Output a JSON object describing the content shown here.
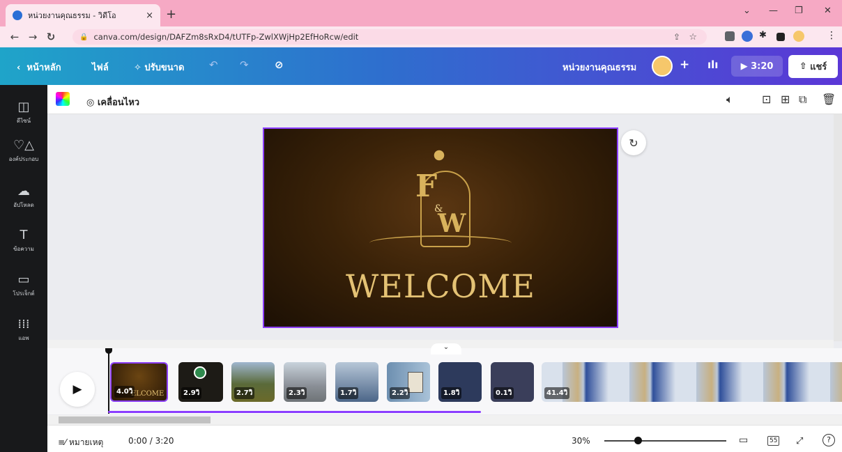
{
  "browser": {
    "tab_title": "หน่วยงานคุณธรรม - วิดีโอ",
    "tab_close": "×",
    "new_tab": "+",
    "url": "canva.com/design/DAFZm8sRxD4/tUTFp-ZwlXWjHp2EfHoRcw/edit",
    "window_controls": [
      "⌄",
      "—",
      "❐",
      "✕"
    ]
  },
  "canva_bar": {
    "home_label": "หน้าหลัก",
    "file_label": "ไฟล์",
    "resize_label": "ปรับขนาด",
    "design_title": "หน่วยงานคุณธรรม",
    "play_time": "3:20",
    "share_label": "แชร์"
  },
  "sidebar": {
    "items": [
      {
        "label": "ดีไซน์",
        "icon": "layout-icon"
      },
      {
        "label": "องค์ประกอบ",
        "icon": "elements-icon"
      },
      {
        "label": "อัปโหลด",
        "icon": "upload-icon"
      },
      {
        "label": "ข้อความ",
        "icon": "text-icon"
      },
      {
        "label": "โปรเจ็กต์",
        "icon": "folder-icon"
      },
      {
        "label": "แอพ",
        "icon": "apps-icon"
      }
    ]
  },
  "toolbar": {
    "animate_label": "เคลื่อนไหว"
  },
  "canvas": {
    "monogram_f": "F",
    "monogram_amp": "&",
    "monogram_w": "W",
    "welcome_text": "WELCOME"
  },
  "timeline": {
    "clips": [
      {
        "duration": "4.0วิ",
        "caption": "ELCOME",
        "color": "#3a2410"
      },
      {
        "duration": "2.9วิ",
        "caption": "",
        "color": "#1d1b16"
      },
      {
        "duration": "2.7วิ",
        "caption": "",
        "color": "#5a6a3a"
      },
      {
        "duration": "2.3วิ",
        "caption": "",
        "color": "#8a8f96"
      },
      {
        "duration": "1.7วิ",
        "caption": "",
        "color": "#4c6688"
      },
      {
        "duration": "2.2วิ",
        "caption": "",
        "color": "#6d8fb0"
      },
      {
        "duration": "1.8วิ",
        "caption": "",
        "color": "#2d3a5c"
      },
      {
        "duration": "0.1วิ",
        "caption": "",
        "color": "#3a3e5a"
      },
      {
        "duration": "41.4วิ",
        "caption": "",
        "color": "#b9c6d8"
      }
    ]
  },
  "bottom": {
    "notes_label": "หมายเหตุ",
    "time_display": "0:00 / 3:20",
    "zoom": "30%",
    "page_count": "55",
    "help": "?"
  }
}
